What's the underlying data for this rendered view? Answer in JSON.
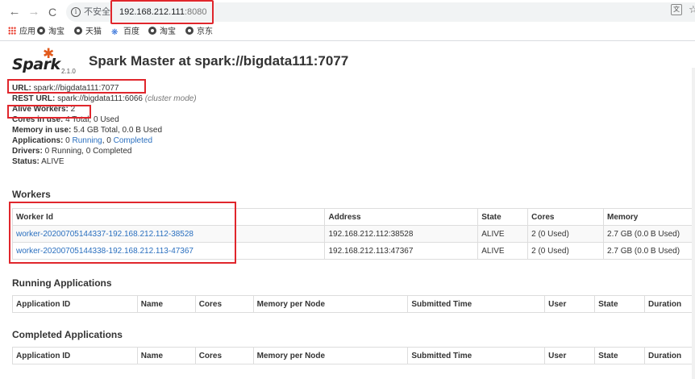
{
  "browser": {
    "back_icon": "arrow-left-icon",
    "forward_icon": "arrow-right-icon",
    "reload_icon": "reload-icon",
    "security_label": "不安全",
    "url_host": "192.168.212.111",
    "url_port": ":8080",
    "bookmarks": [
      {
        "label": "应用",
        "icon": "apps-grid-icon"
      },
      {
        "label": "淘宝",
        "icon": "globe-icon"
      },
      {
        "label": "天猫",
        "icon": "globe-icon"
      },
      {
        "label": "百度",
        "icon": "baidu-paw-icon"
      },
      {
        "label": "淘宝",
        "icon": "globe-icon"
      },
      {
        "label": "京东",
        "icon": "globe-icon"
      }
    ]
  },
  "page": {
    "logo_version": "2.1.0",
    "title": "Spark Master at spark://bigdata111:7077",
    "summary": {
      "url_label": "URL:",
      "url_value": " spark://bigdata111:7077",
      "rest_label": "REST URL:",
      "rest_value": " spark://bigdata111:6066",
      "rest_mode": "(cluster mode)",
      "alive_label": "Alive Workers:",
      "alive_value": " 2",
      "cores_label": "Cores in use:",
      "cores_value": " 4 Total, 0 Used",
      "memory_label": "Memory in use:",
      "memory_value": " 5.4 GB Total, 0.0 B Used",
      "apps_label": "Applications:",
      "apps_running_count": " 0 ",
      "apps_running_link": "Running",
      "apps_sep": ", 0 ",
      "apps_completed_link": "Completed",
      "drivers_label": "Drivers:",
      "drivers_value": " 0 Running, 0 Completed",
      "status_label": "Status:",
      "status_value": " ALIVE"
    },
    "workers": {
      "title": "Workers",
      "headers": [
        "Worker Id",
        "Address",
        "State",
        "Cores",
        "Memory"
      ],
      "rows": [
        [
          "worker-20200705144337-192.168.212.112-38528",
          "192.168.212.112:38528",
          "ALIVE",
          "2 (0 Used)",
          "2.7 GB (0.0 B Used)"
        ],
        [
          "worker-20200705144338-192.168.212.113-47367",
          "192.168.212.113:47367",
          "ALIVE",
          "2 (0 Used)",
          "2.7 GB (0.0 B Used)"
        ]
      ]
    },
    "running_apps": {
      "title": "Running Applications",
      "headers": [
        "Application ID",
        "Name",
        "Cores",
        "Memory per Node",
        "Submitted Time",
        "User",
        "State",
        "Duration"
      ]
    },
    "completed_apps": {
      "title": "Completed Applications",
      "headers": [
        "Application ID",
        "Name",
        "Cores",
        "Memory per Node",
        "Submitted Time",
        "User",
        "State",
        "Duration"
      ]
    }
  },
  "colors": {
    "highlight": "#e0262c",
    "link": "#2a6fbf",
    "spark_orange": "#e25a1c"
  }
}
